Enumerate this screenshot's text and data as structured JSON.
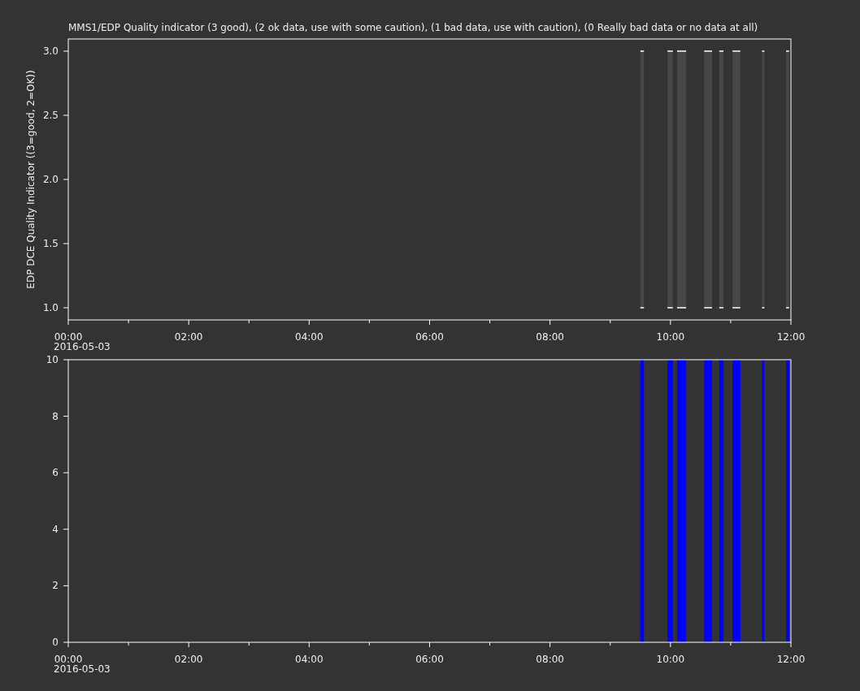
{
  "charts": [
    {
      "title": "MMS1/EDP  Quality indicator (3 good), (2 ok data, use with some caution), (1 bad data, use with caution), (0 Really bad data or no data at all)",
      "date_label": "2016-05-03",
      "chart_data": {
        "type": "area",
        "ylabel": "EDP DCE Quality Indicator ((3=good, 2=OK))",
        "xlim": [
          0,
          12
        ],
        "ylim": [
          0.905,
          3.095
        ],
        "x": [
          9.5,
          9.56,
          9.95,
          10.04,
          10.11,
          10.26,
          10.56,
          10.69,
          10.81,
          10.88,
          11.03,
          11.16,
          11.52,
          11.56,
          11.92,
          11.97
        ],
        "series": [
          {
            "color": "#474747",
            "values": [
              3,
              3,
              3,
              3,
              3,
              3,
              3,
              3,
              3,
              3,
              3,
              3,
              3,
              3,
              3,
              3
            ]
          }
        ],
        "xticks": [
          {
            "value": 0,
            "label": "00:00"
          },
          {
            "value": 2,
            "label": "02:00"
          },
          {
            "value": 4,
            "label": "04:00"
          },
          {
            "value": 6,
            "label": "06:00"
          },
          {
            "value": 8,
            "label": "08:00"
          },
          {
            "value": 10,
            "label": "10:00"
          },
          {
            "value": 12,
            "label": "12:00"
          }
        ],
        "yticks": [
          {
            "value": 1,
            "label": "1.0"
          },
          {
            "value": 1.5,
            "label": "1.5"
          },
          {
            "value": 2,
            "label": "2.0"
          },
          {
            "value": 2.5,
            "label": "2.5"
          },
          {
            "value": 3,
            "label": "3.0"
          }
        ]
      }
    },
    {
      "date_label": "2016-05-03",
      "chart_data": {
        "type": "area",
        "xlim": [
          0,
          12
        ],
        "ylim": [
          0,
          10
        ],
        "x": [
          9.5,
          9.56,
          9.95,
          10.04,
          10.11,
          10.26,
          10.56,
          10.69,
          10.81,
          10.88,
          11.03,
          11.16,
          11.52,
          11.56,
          11.92,
          11.97
        ],
        "series": [
          {
            "color": "#0000ff",
            "values": [
              10,
              10,
              10,
              10,
              10,
              10,
              10,
              10,
              10,
              10,
              10,
              10,
              10,
              10,
              10,
              10
            ]
          }
        ],
        "xticks": [
          {
            "value": 0,
            "label": "00:00"
          },
          {
            "value": 2,
            "label": "02:00"
          },
          {
            "value": 4,
            "label": "04:00"
          },
          {
            "value": 6,
            "label": "06:00"
          },
          {
            "value": 8,
            "label": "08:00"
          },
          {
            "value": 10,
            "label": "10:00"
          },
          {
            "value": 12,
            "label": "12:00"
          }
        ],
        "yticks": [
          0,
          2,
          4,
          6,
          8,
          10
        ]
      }
    }
  ]
}
